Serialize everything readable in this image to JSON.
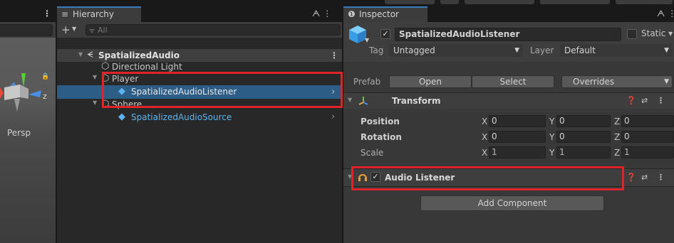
{
  "scene": {
    "menu_glyph": "⋮",
    "persp_label": "Persp"
  },
  "hierarchy": {
    "tab_label": "Hierarchy",
    "tab_icon": "≡",
    "lock_icon": "🔓",
    "menu_glyph": "⋮",
    "add_glyph": "+",
    "search_placeholder": "All",
    "scene_name": "SpatializedAudio",
    "rows": [
      {
        "label": "Directional Light"
      },
      {
        "label": "Player"
      },
      {
        "label": "SpatializedAudioListener"
      },
      {
        "label": "Sphere"
      },
      {
        "label": "SpatializedAudioSource"
      }
    ]
  },
  "inspector": {
    "tab_label": "Inspector",
    "tab_icon": "❶",
    "object_name": "SpatializedAudioListener",
    "static_label": "Static",
    "tag_label": "Tag",
    "tag_value": "Untagged",
    "layer_label": "Layer",
    "layer_value": "Default",
    "prefab_label": "Prefab",
    "open_button": "Open",
    "select_button": "Select",
    "overrides_button": "Overrides",
    "transform": {
      "title": "Transform",
      "position_label": "Position",
      "rotation_label": "Rotation",
      "scale_label": "Scale",
      "axis_x": "X",
      "axis_y": "Y",
      "axis_z": "Z",
      "position": {
        "x": "0",
        "y": "0",
        "z": "0"
      },
      "rotation": {
        "x": "0",
        "y": "0",
        "z": "0"
      },
      "scale": {
        "x": "1",
        "y": "1",
        "z": "1"
      }
    },
    "audio_listener": {
      "title": "Audio Listener"
    },
    "add_component_button": "Add Component"
  },
  "colors": {
    "selection": "#2c5d87",
    "highlight_red": "#e0222a",
    "prefab_blue": "#5cb3f0",
    "headphone_orange": "#f0a030"
  },
  "icons": {
    "checkmark": "✓",
    "help": "❓",
    "menu": "⋮",
    "preset": "⇄"
  }
}
